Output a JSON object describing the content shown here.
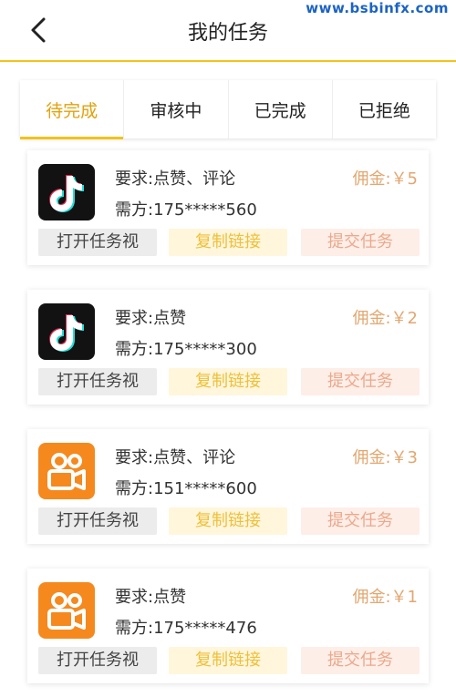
{
  "watermark": "www.bsbinfx.com",
  "header": {
    "title": "我的任务"
  },
  "tabs": [
    {
      "label": "待完成",
      "active": true
    },
    {
      "label": "审核中",
      "active": false
    },
    {
      "label": "已完成",
      "active": false
    },
    {
      "label": "已拒绝",
      "active": false
    }
  ],
  "tasks": [
    {
      "app_icon": "tiktok-icon",
      "requirement": "要求:点赞、评论",
      "party": "需方:175*****560",
      "commission": "佣金:￥5",
      "open_label": "打开任务视",
      "copy_label": "复制链接",
      "submit_label": "提交任务"
    },
    {
      "app_icon": "tiktok-icon",
      "requirement": "要求:点赞",
      "party": "需方:175*****300",
      "commission": "佣金:￥2",
      "open_label": "打开任务视",
      "copy_label": "复制链接",
      "submit_label": "提交任务"
    },
    {
      "app_icon": "kuaishou-icon",
      "requirement": "要求:点赞、评论",
      "party": "需方:151*****600",
      "commission": "佣金:￥3",
      "open_label": "打开任务视",
      "copy_label": "复制链接",
      "submit_label": "提交任务"
    },
    {
      "app_icon": "kuaishou-icon",
      "requirement": "要求:点赞",
      "party": "需方:175*****476",
      "commission": "佣金:￥1",
      "open_label": "打开任务视",
      "copy_label": "复制链接",
      "submit_label": "提交任务"
    }
  ],
  "colors": {
    "accent": "#f2c318",
    "active_tab": "#e2a20d",
    "commission": "#e2a770",
    "kuaishou": "#f5891e",
    "tiktok": "#121212"
  }
}
